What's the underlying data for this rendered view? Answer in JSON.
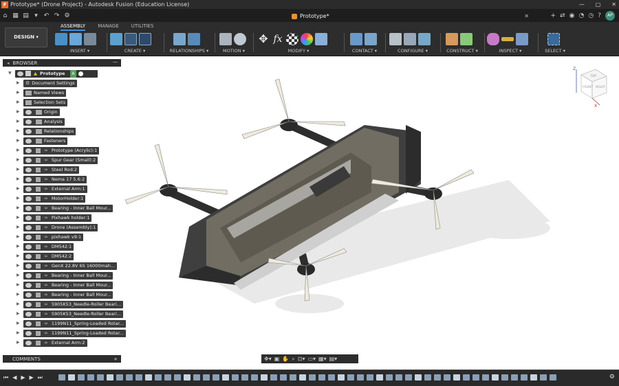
{
  "window": {
    "title": "Prototype* (Drone Project) - Autodesk Fusion (Education License)"
  },
  "document_tab": {
    "label": "Prototype*"
  },
  "user": {
    "initials": "AP"
  },
  "workspace": {
    "label": "DESIGN ▾"
  },
  "ribbon_tabs": [
    "ASSEMBLY",
    "MANAGE",
    "UTILITIES"
  ],
  "groups": [
    "INSERT ▾",
    "CREATE ▾",
    "RELATIONSHIPS ▾",
    "MOTION ▾",
    "MODIFY ▾",
    "CONTACT ▾",
    "CONFIGURE ▾",
    "CONSTRUCT ▾",
    "INSPECT ▾",
    "SELECT ▾"
  ],
  "browser": {
    "title": "BROWSER",
    "root": "Prototype"
  },
  "tree": [
    {
      "label": "Document Settings",
      "kind": "gear"
    },
    {
      "label": "Named Views",
      "kind": "folder"
    },
    {
      "label": "Selection Sets",
      "kind": "folder"
    },
    {
      "label": "Origin",
      "kind": "eyefolder"
    },
    {
      "label": "Analysis",
      "kind": "eyefolder"
    },
    {
      "label": "Relationships",
      "kind": "eyefolder"
    },
    {
      "label": "Fasteners",
      "kind": "eyefolder"
    },
    {
      "label": "Prototype (Acrylic):1",
      "kind": "comp"
    },
    {
      "label": "Spur Gear (Small):2",
      "kind": "comp"
    },
    {
      "label": "Steel Rod:2",
      "kind": "comp"
    },
    {
      "label": "Nema 17 5.6:2",
      "kind": "comp"
    },
    {
      "label": "External Arm:1",
      "kind": "comp"
    },
    {
      "label": "MotorHolder:1",
      "kind": "comp"
    },
    {
      "label": "Bearing - Inner Ball Mour...",
      "kind": "comp"
    },
    {
      "label": "Pixhawk holder:1",
      "kind": "comp"
    },
    {
      "label": "Drone (Assembly):1",
      "kind": "comp"
    },
    {
      "label": "pixhawk v9:1",
      "kind": "comp"
    },
    {
      "label": "DM542:1",
      "kind": "comp"
    },
    {
      "label": "DM542:2",
      "kind": "comp"
    },
    {
      "label": "GenX 22.8V 6S 16000mah...",
      "kind": "comp"
    },
    {
      "label": "Bearing - Inner Ball Mour...",
      "kind": "comp"
    },
    {
      "label": "Bearing - Inner Ball Mour...",
      "kind": "comp"
    },
    {
      "label": "Bearing - Inner Ball Mour...",
      "kind": "comp"
    },
    {
      "label": "5905K53_Needle-Roller Beari...",
      "kind": "comp"
    },
    {
      "label": "5905K53_Needle-Roller Beari...",
      "kind": "comp"
    },
    {
      "label": "1199N11_Spring-Loaded Rotar...",
      "kind": "comp"
    },
    {
      "label": "1199N11_Spring-Loaded Rotar...",
      "kind": "comp"
    },
    {
      "label": "External Arm:2",
      "kind": "comp"
    }
  ],
  "comments": {
    "label": "COMMENTS"
  },
  "viewcube": {
    "top": "TOP",
    "front": "FRONT",
    "right": "RIGHT",
    "z": "Z",
    "x": "X"
  },
  "colors": {
    "accent": "#3a8fde",
    "panel": "#2d2d2d",
    "titlebar": "#2b2b2b"
  }
}
